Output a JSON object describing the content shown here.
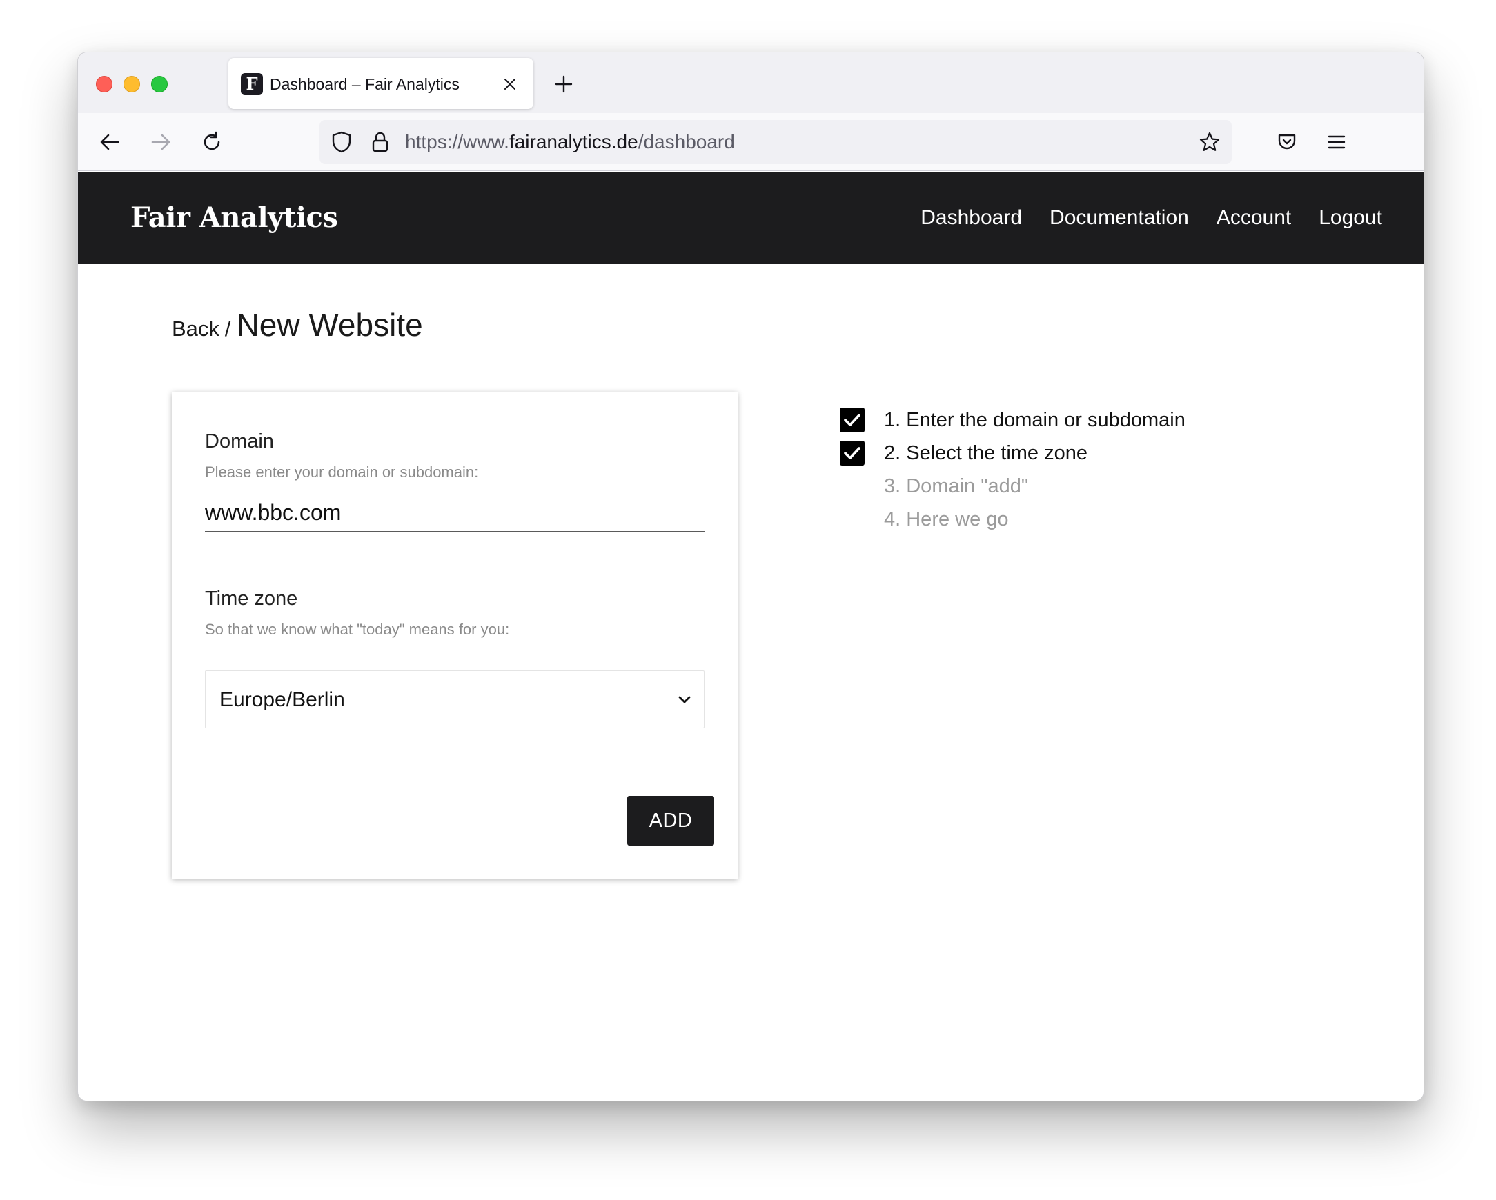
{
  "browser": {
    "tab": {
      "favicon_letter": "F",
      "title": "Dashboard – Fair Analytics"
    },
    "url": {
      "scheme": "https://www.",
      "host": "fairanalytics.de",
      "path": "/dashboard"
    }
  },
  "site": {
    "logo": "Fair Analytics",
    "nav": [
      "Dashboard",
      "Documentation",
      "Account",
      "Logout"
    ]
  },
  "breadcrumb": {
    "back": "Back",
    "separator": "/",
    "title": "New Website"
  },
  "form": {
    "domain": {
      "label": "Domain",
      "help": "Please enter your domain or subdomain:",
      "value": "www.bbc.com"
    },
    "timezone": {
      "label": "Time zone",
      "help": "So that we know what \"today\" means for you:",
      "selected": "Europe/Berlin"
    },
    "submit_label": "ADD"
  },
  "steps": [
    {
      "text": "1. Enter the domain or subdomain",
      "checked": true
    },
    {
      "text": "2. Select the time zone",
      "checked": true
    },
    {
      "text": "3. Domain \"add\"",
      "checked": false
    },
    {
      "text": "4. Here we go",
      "checked": false
    }
  ],
  "colors": {
    "header_bg": "#1c1c1e",
    "button_bg": "#1c1c1e",
    "muted_text": "#9b9b9b"
  }
}
